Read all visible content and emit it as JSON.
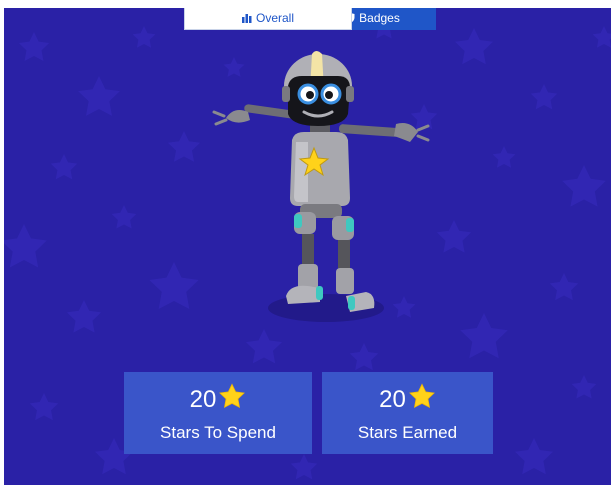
{
  "tabs": {
    "overall_label": "Overall",
    "badges_label": "Badges",
    "overall_icon": "bar-chart-icon",
    "badges_icon": "shield-icon"
  },
  "stats": {
    "spend": {
      "value": "20",
      "label": "Stars To Spend"
    },
    "earned": {
      "value": "20",
      "label": "Stars Earned"
    }
  },
  "colors": {
    "background": "#2a21a6",
    "card": "#3a55c9",
    "star": "#ffd21a",
    "tab_active_text": "#1f56c8",
    "tab_inactive_bg": "#1f56c8"
  }
}
